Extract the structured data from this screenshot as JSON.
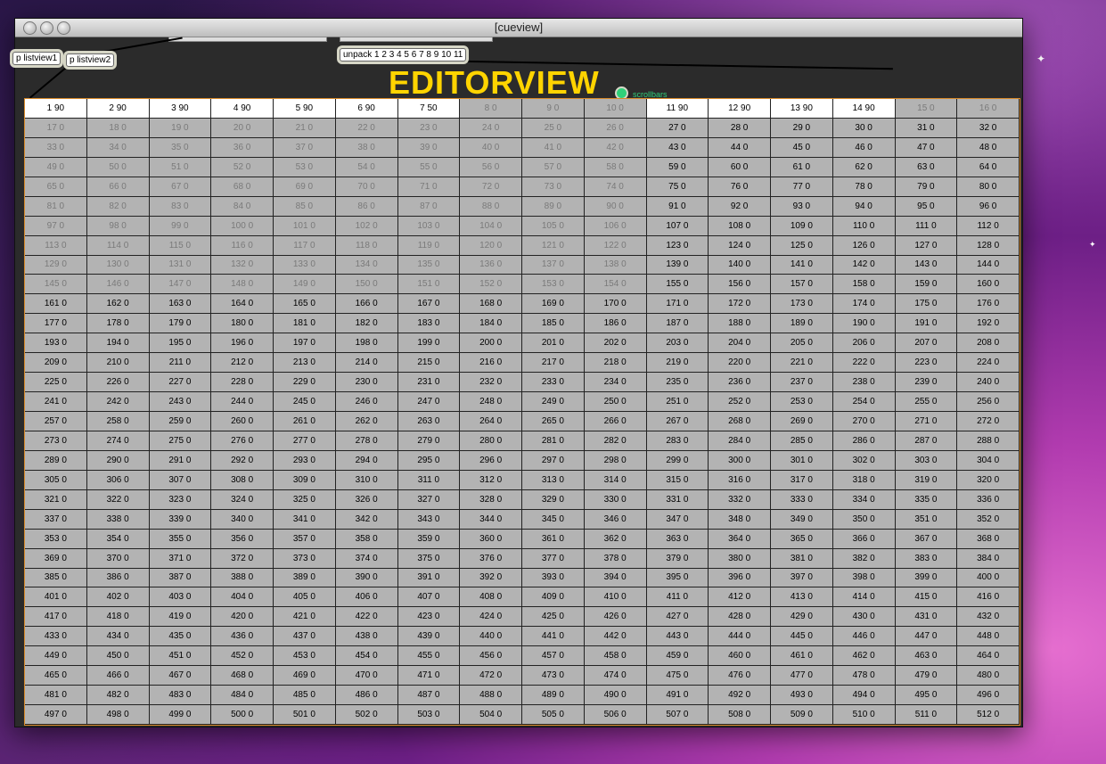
{
  "window": {
    "title": "[cueview]"
  },
  "patch": {
    "objects": [
      "p listview1",
      "p listview2",
      "unpack 1 2 3 4 5 6 7 8 9 10 11"
    ],
    "editor_label": "EDITORVIEW",
    "toggle_label": "scrollbars"
  },
  "grid": {
    "columns": 16,
    "rows": 32,
    "first_row_values": [
      "1 90",
      "2 90",
      "3 90",
      "4 90",
      "5 90",
      "6 90",
      "7 50",
      "8 0",
      "9 0",
      "10 0",
      "11 90",
      "12 90",
      "13 90",
      "14 90",
      "15 0",
      "16 0"
    ],
    "default_suffix": " 0",
    "highlighted_cells": [
      1,
      2,
      3,
      4,
      5,
      6,
      7,
      11,
      12,
      13,
      14
    ],
    "dimmed_rows": [
      2,
      3,
      4,
      5,
      6,
      7,
      8,
      9,
      10
    ],
    "dimmed_columns_count": 10,
    "colors": {
      "highlight": "#ffffff",
      "default": "#b3b3b3",
      "dim_text": "#7a7a7a",
      "border_accent": "#d88a2a"
    }
  }
}
